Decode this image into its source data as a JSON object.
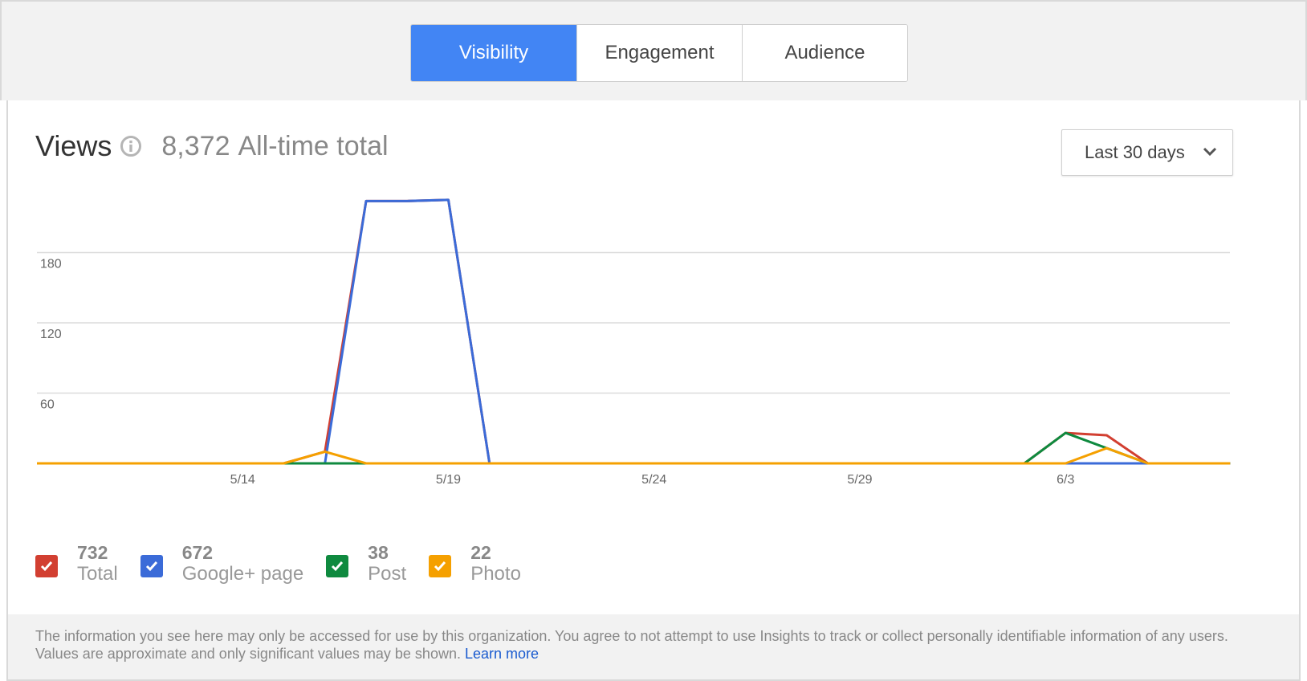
{
  "tabs": [
    {
      "label": "Visibility",
      "active": true
    },
    {
      "label": "Engagement",
      "active": false
    },
    {
      "label": "Audience",
      "active": false
    }
  ],
  "header": {
    "title": "Views",
    "total_value": "8,372",
    "total_label": "All-time total"
  },
  "range_select": {
    "label": "Last 30 days"
  },
  "legend": [
    {
      "value": "732",
      "label": "Total",
      "color": "#d23f31",
      "checked": true
    },
    {
      "value": "672",
      "label": "Google+ page",
      "color": "#3b6bd8",
      "checked": true
    },
    {
      "value": "38",
      "label": "Post",
      "color": "#0f8a3f",
      "checked": true
    },
    {
      "value": "22",
      "label": "Photo",
      "color": "#f5a000",
      "checked": true
    }
  ],
  "footer": {
    "text": "The information you see here may only be accessed for use by this organization. You agree to not attempt to use Insights to track or collect personally identifiable information of any users. Values are approximate and only significant values may be shown.",
    "link": "Learn more"
  },
  "chart_data": {
    "type": "line",
    "x": [
      "5/9",
      "5/10",
      "5/11",
      "5/12",
      "5/13",
      "5/14",
      "5/15",
      "5/16",
      "5/17",
      "5/18",
      "5/19",
      "5/20",
      "5/21",
      "5/22",
      "5/23",
      "5/24",
      "5/25",
      "5/26",
      "5/27",
      "5/28",
      "5/29",
      "5/30",
      "5/31",
      "6/1",
      "6/2",
      "6/3",
      "6/4",
      "6/5",
      "6/6",
      "6/7"
    ],
    "x_ticks": [
      "5/14",
      "5/19",
      "5/24",
      "5/29",
      "6/3"
    ],
    "y_ticks": [
      "60",
      "120",
      "180"
    ],
    "ylim": [
      0,
      240
    ],
    "grid": true,
    "series": [
      {
        "name": "Total",
        "color": "#d23f31",
        "values": [
          0,
          0,
          0,
          0,
          0,
          0,
          0,
          10,
          224,
          224,
          225,
          0,
          0,
          0,
          0,
          0,
          0,
          0,
          0,
          0,
          0,
          0,
          0,
          0,
          0,
          26,
          24,
          0,
          0,
          0
        ]
      },
      {
        "name": "Google+ page",
        "color": "#3b6bd8",
        "values": [
          0,
          0,
          0,
          0,
          0,
          0,
          0,
          0,
          224,
          224,
          225,
          0,
          0,
          0,
          0,
          0,
          0,
          0,
          0,
          0,
          0,
          0,
          0,
          0,
          0,
          0,
          0,
          0,
          0,
          0
        ]
      },
      {
        "name": "Post",
        "color": "#0f8a3f",
        "values": [
          0,
          0,
          0,
          0,
          0,
          0,
          0,
          0,
          0,
          0,
          0,
          0,
          0,
          0,
          0,
          0,
          0,
          0,
          0,
          0,
          0,
          0,
          0,
          0,
          0,
          26,
          13,
          0,
          0,
          0
        ]
      },
      {
        "name": "Photo",
        "color": "#f5a000",
        "values": [
          0,
          0,
          0,
          0,
          0,
          0,
          0,
          10,
          0,
          0,
          0,
          0,
          0,
          0,
          0,
          0,
          0,
          0,
          0,
          0,
          0,
          0,
          0,
          0,
          0,
          0,
          13,
          0,
          0,
          0
        ]
      }
    ]
  }
}
